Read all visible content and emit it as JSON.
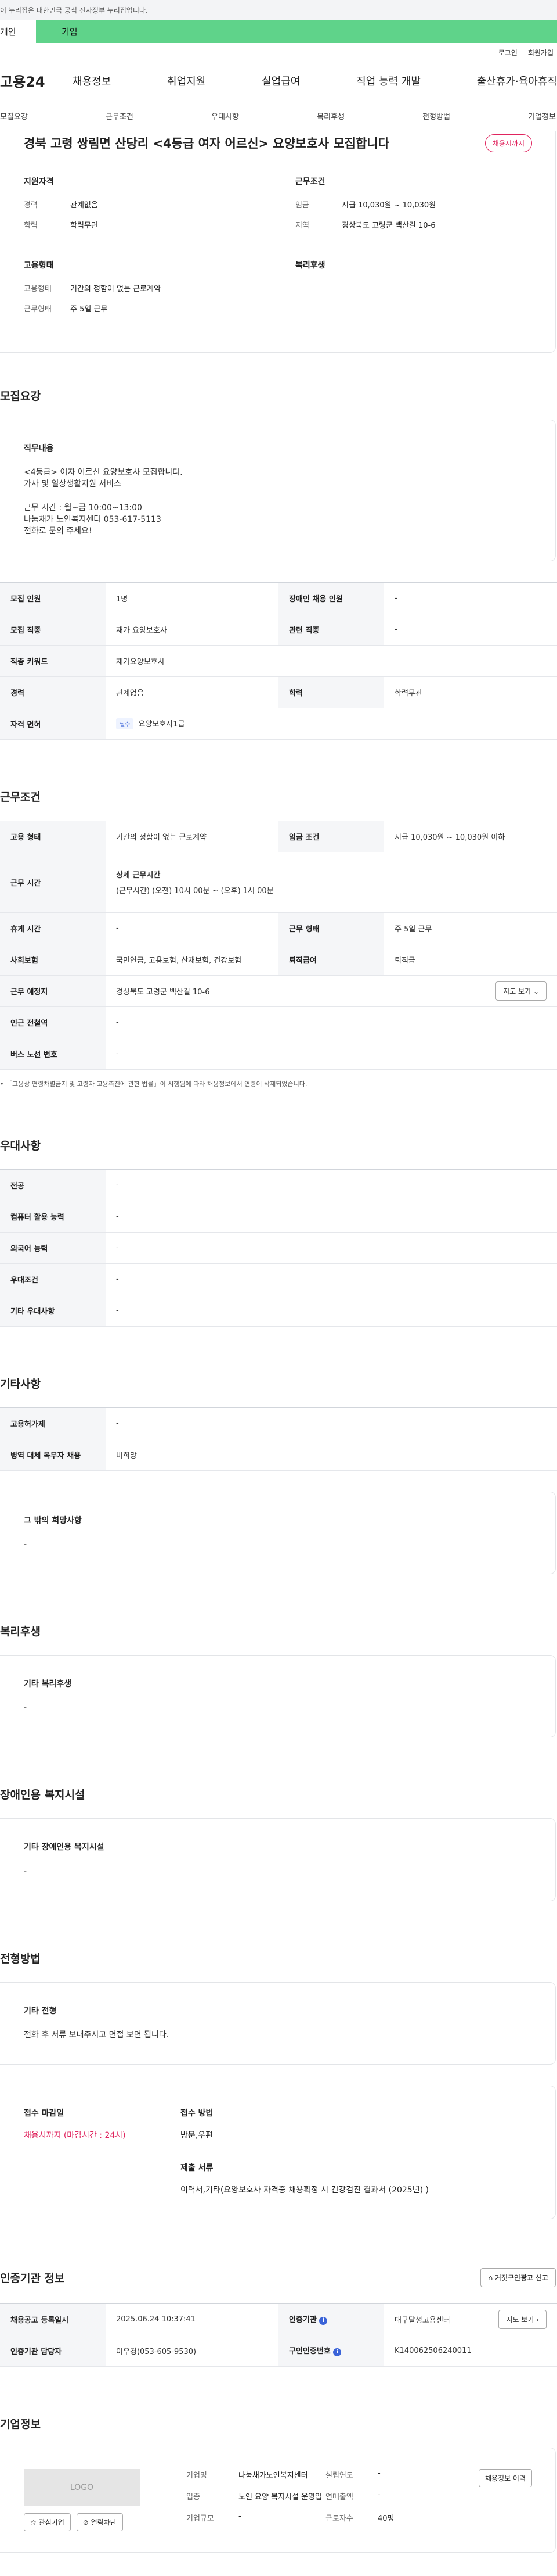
{
  "gov_banner": "이 누리집은 대한민국 공식 전자정부 누리집입니다.",
  "tabs": {
    "person": "개인",
    "biz": "기업"
  },
  "top_links": [
    "로그인",
    "회원가입"
  ],
  "logo": "고용24",
  "gnb": [
    "채용정보",
    "취업지원",
    "실업급여",
    "직업 능력 개발",
    "출산휴가·육아휴직"
  ],
  "anchors": [
    "모집요강",
    "근무조건",
    "우대사항",
    "복리후생",
    "전형방법",
    "기업정보"
  ],
  "job": {
    "title": "경북 고령 쌍림면 산당리 <4등급 여자 어르신> 요양보호사 모집합니다",
    "status_badge": "채용시까지",
    "summary": {
      "qual_title": "지원자격",
      "career_label": "경력",
      "career": "관계없음",
      "edu_label": "학력",
      "edu": "학력무관",
      "cond_title": "근무조건",
      "wage_label": "임금",
      "wage": "시급 10,030원 ~ 10,030원",
      "area_label": "지역",
      "area": "경상북도 고령군 백산길 10-6",
      "emp_title": "고용형태",
      "emp_type_label": "고용형태",
      "emp_type": "기간의 정함이 없는 근로계약",
      "work_label": "근무형태",
      "work": "주 5일 근무",
      "welfare_title": "복리후생"
    }
  },
  "recruit": {
    "section": "모집요강",
    "duty_title": "직무내용",
    "duty_text": "<4등급> 여자 어르신 요양보호사 모집합니다.\n가사 및 일상생활지원 서비스\n\n근무 시간 : 월~금 10:00~13:00\n나눔채가 노인복지센터 053-617-5113\n전화로 문의 주세요!",
    "rows": [
      {
        "k1": "모집 인원",
        "v1": "1명",
        "k2": "장애인 채용 인원",
        "v2": "-"
      },
      {
        "k1": "모집 직종",
        "v1": "재가 요양보호사",
        "k2": "관련 직종",
        "v2": "-"
      },
      {
        "k1": "직종 키워드",
        "v1": "재가요양보호사"
      },
      {
        "k1": "경력",
        "v1": "관계없음",
        "k2": "학력",
        "v2": "학력무관"
      },
      {
        "k1": "자격 면허",
        "tag": "필수",
        "v1": "요양보호사1급"
      }
    ]
  },
  "conditions": {
    "section": "근무조건",
    "r1": {
      "k1": "고용 형태",
      "v1": "기간의 정함이 없는 근로계약",
      "k2": "임금 조건",
      "v2": "시급 10,030원 ~ 10,030원 이하"
    },
    "r2": {
      "k": "근무 시간",
      "sub": "상세 근무시간",
      "v": "(근무시간) (오전) 10시 00분 ~ (오후) 1시 00분"
    },
    "r3": {
      "k1": "휴게 시간",
      "v1": "-",
      "k2": "근무 형태",
      "v2": "주 5일 근무"
    },
    "r4": {
      "k1": "사회보험",
      "v1": "국민연금, 고용보험, 산재보험, 건강보험",
      "k2": "퇴직급여",
      "v2": "퇴직금"
    },
    "r5": {
      "k": "근무 예정지",
      "v": "경상북도 고령군 백산길 10-6",
      "btn": "지도 보기"
    },
    "r6": {
      "k": "인근 전철역",
      "v": "-"
    },
    "r7": {
      "k": "버스 노선 번호",
      "v": "-"
    },
    "footnote": "「고용상 연령차별금지 및 고령자 고용촉진에 관한 법률」이 시행됨에 따라 채용정보에서 연령이 삭제되었습니다."
  },
  "preference": {
    "section": "우대사항",
    "rows": [
      {
        "k": "전공",
        "v": "-"
      },
      {
        "k": "컴퓨터 활용 능력",
        "v": "-"
      },
      {
        "k": "외국어 능력",
        "v": "-"
      },
      {
        "k": "우대조건",
        "v": "-"
      },
      {
        "k": "기타 우대사항",
        "v": "-"
      }
    ]
  },
  "etc": {
    "section": "기타사항",
    "rows": [
      {
        "k": "고용허가제",
        "v": "-"
      },
      {
        "k": "병역 대체 복무자 채용",
        "v": "비희망"
      }
    ],
    "other_title": "그 밖의 희망사항",
    "other_value": "-"
  },
  "welfare": {
    "section": "복리후생",
    "title": "기타 복리후생",
    "value": "-"
  },
  "disabled": {
    "section": "장애인용 복지시설",
    "title": "기타 장애인용 복지시설",
    "value": "-"
  },
  "selection": {
    "section": "전형방법",
    "etc_title": "기타 전형",
    "etc_value": "전화 후 서류 보내주시고 면접 보면 됩니다.",
    "deadline_title": "접수 마감일",
    "deadline_value": "채용시까지 (마감시간 : 24시)",
    "method_title": "접수 방법",
    "method_value": "방문,우편",
    "docs_title": "제출 서류",
    "docs_value": "이력서,기타(요양보호사 자격증 채용확정 시  건강검진 결과서 (2025년) )"
  },
  "cert": {
    "section": "인증기관 정보",
    "report_btn": "거짓구인광고 신고",
    "r1": {
      "k1": "채용공고 등록일시",
      "v1": "2025.06.24 10:37:41",
      "k2": "인증기관",
      "v2": "대구달성고용센터",
      "btn": "지도 보기"
    },
    "r2": {
      "k1": "인증기관 담당자",
      "v1": "이우경(053-605-9530)",
      "k2": "구인인증번호",
      "v2": "K140062506240011"
    }
  },
  "company": {
    "section": "기업정보",
    "logo_text": "LOGO",
    "fav_btn": "관심기업",
    "block_btn": "열람차단",
    "name_label": "기업명",
    "name": "나눔채가노인복지센터",
    "industry_label": "업종",
    "industry": "노인 요양 복지시설 운영업",
    "size_label": "기업규모",
    "size": "-",
    "founded_label": "설립연도",
    "founded": "-",
    "sales_label": "연매출액",
    "sales": "-",
    "employees_label": "근로자수",
    "employees": "40명",
    "history_btn": "채용정보 이력"
  }
}
